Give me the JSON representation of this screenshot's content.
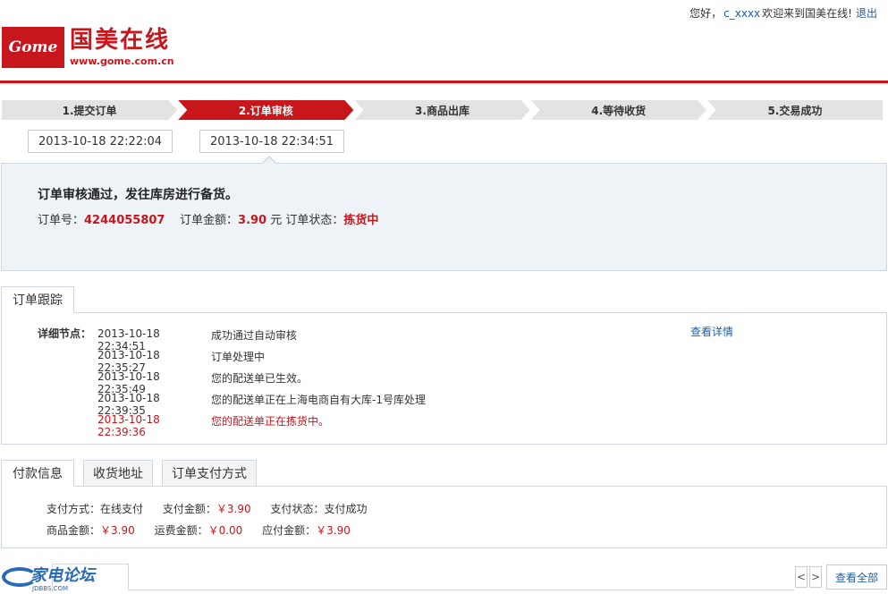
{
  "topbar": {
    "greeting": "您好，",
    "username": "c_xxxx",
    "welcome": "欢迎来到国美在线!",
    "logout": "退出"
  },
  "logo": {
    "mark": "Gome",
    "name": "国美在线",
    "url": "www.gome.com.cn"
  },
  "steps": [
    {
      "label": "1.提交订单",
      "active": false
    },
    {
      "label": "2.订单审核",
      "active": true
    },
    {
      "label": "3.商品出库",
      "active": false
    },
    {
      "label": "4.等待收货",
      "active": false
    },
    {
      "label": "5.交易成功",
      "active": false
    }
  ],
  "times": [
    "2013-10-18 22:22:04",
    "2013-10-18 22:34:51"
  ],
  "status": {
    "message": "订单审核通过，发往库房进行备货。",
    "order_no_label": "订单号：",
    "order_no": "4244055807",
    "amount_label": "订单金额：",
    "amount": "3.90",
    "amount_unit": "元",
    "state_label": "订单状态：",
    "state": "拣货中"
  },
  "tracking": {
    "tab": "订单跟踪",
    "label": "详细节点：",
    "detail_link": "查看详情",
    "items": [
      {
        "time": "2013-10-18 22:34:51",
        "text": "成功通过自动审核"
      },
      {
        "time": "2013-10-18 22:35:27",
        "text": "订单处理中"
      },
      {
        "time": "2013-10-18 22:35:49",
        "text": "您的配送单已生效。"
      },
      {
        "time": "2013-10-18 22:39:35",
        "text": "您的配送单正在上海电商自有大库-1号库处理"
      },
      {
        "time": "2013-10-18 22:39:36",
        "text": "您的配送单正在拣货中。"
      }
    ]
  },
  "payment": {
    "tabs": [
      "付款信息",
      "收货地址",
      "订单支付方式"
    ],
    "method_label": "支付方式：",
    "method": "在线支付",
    "paid_label": "支付金额：",
    "paid": "￥3.90",
    "pay_state_label": "支付状态：",
    "pay_state": "支付成功",
    "goods_label": "商品金额：",
    "goods": "￥3.90",
    "ship_label": "运费金额：",
    "ship": "￥0.00",
    "due_label": "应付金额：",
    "due": "￥3.90"
  },
  "bottom": {
    "forum": "家电论坛",
    "forum_url": "JDBBS.COM",
    "prev": "<",
    "next": ">",
    "view_all": "查看全部"
  }
}
